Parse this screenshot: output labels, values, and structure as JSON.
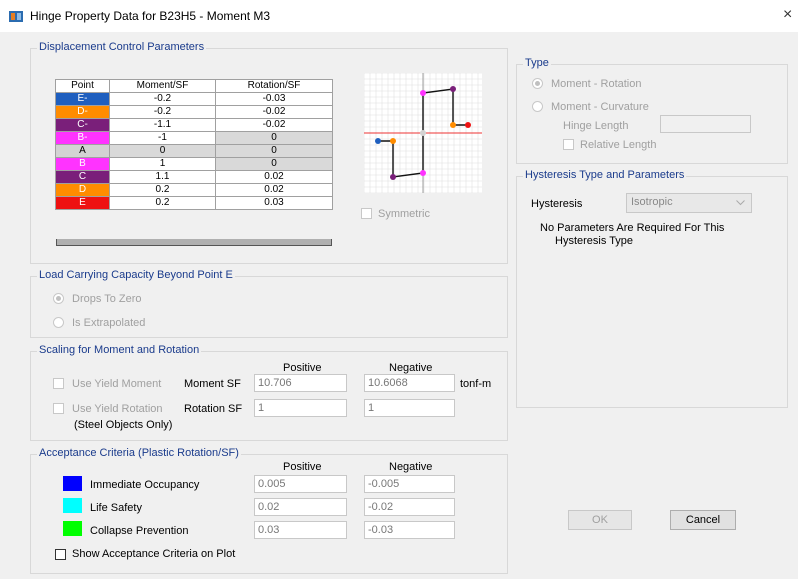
{
  "window": {
    "title": "Hinge Property Data for B23H5 - Moment M3",
    "close_glyph": "×"
  },
  "displacement": {
    "group_label": "Displacement Control Parameters",
    "table": {
      "headers": [
        "Point",
        "Moment/SF",
        "Rotation/SF"
      ],
      "rows": [
        {
          "point": "E-",
          "moment": "-0.2",
          "rotation": "-0.03",
          "color": "#1f5fbf"
        },
        {
          "point": "D-",
          "moment": "-0.2",
          "rotation": "-0.02",
          "color": "#ff8c00"
        },
        {
          "point": "C-",
          "moment": "-1.1",
          "rotation": "-0.02",
          "color": "#7a1f7a"
        },
        {
          "point": "B-",
          "moment": "-1",
          "rotation": "0",
          "color": "#ff33ff"
        },
        {
          "point": "A",
          "moment": "0",
          "rotation": "0",
          "color": "#d3d3d3"
        },
        {
          "point": "B",
          "moment": "1",
          "rotation": "0",
          "color": "#ff33ff"
        },
        {
          "point": "C",
          "moment": "1.1",
          "rotation": "0.02",
          "color": "#7a1f7a"
        },
        {
          "point": "D",
          "moment": "0.2",
          "rotation": "0.02",
          "color": "#ff8c00"
        },
        {
          "point": "E",
          "moment": "0.2",
          "rotation": "0.03",
          "color": "#ee1111"
        }
      ]
    },
    "symmetric_label": "Symmetric"
  },
  "load_capacity": {
    "group_label": "Load Carrying Capacity Beyond Point E",
    "option_drops": "Drops To Zero",
    "option_extrapolated": "Is Extrapolated"
  },
  "scaling": {
    "group_label": "Scaling for Moment and Rotation",
    "positive_header": "Positive",
    "negative_header": "Negative",
    "use_yield_moment": "Use Yield Moment",
    "moment_sf_label": "Moment SF",
    "moment_pos": "10.706",
    "moment_neg": "10.6068",
    "moment_unit": "tonf-m",
    "use_yield_rotation": "Use Yield Rotation",
    "rotation_sf_label": "Rotation SF",
    "rotation_pos": "1",
    "rotation_neg": "1",
    "steel_only": "(Steel Objects Only)"
  },
  "acceptance": {
    "group_label": "Acceptance Criteria (Plastic Rotation/SF)",
    "positive_header": "Positive",
    "negative_header": "Negative",
    "rows": [
      {
        "label": "Immediate Occupancy",
        "positive": "0.005",
        "negative": "-0.005",
        "color": "#0000ff"
      },
      {
        "label": "Life Safety",
        "positive": "0.02",
        "negative": "-0.02",
        "color": "#00ffff"
      },
      {
        "label": "Collapse Prevention",
        "positive": "0.03",
        "negative": "-0.03",
        "color": "#00ff00"
      }
    ],
    "show_on_plot": "Show Acceptance Criteria on Plot"
  },
  "type": {
    "group_label": "Type",
    "moment_rotation": "Moment - Rotation",
    "moment_curvature": "Moment - Curvature",
    "hinge_length": "Hinge Length",
    "relative_length": "Relative Length"
  },
  "hysteresis": {
    "group_label": "Hysteresis Type and Parameters",
    "label": "Hysteresis",
    "value": "Isotropic",
    "note_line1": "No Parameters Are Required For This",
    "note_line2": "Hysteresis Type"
  },
  "buttons": {
    "ok": "OK",
    "cancel": "Cancel"
  }
}
